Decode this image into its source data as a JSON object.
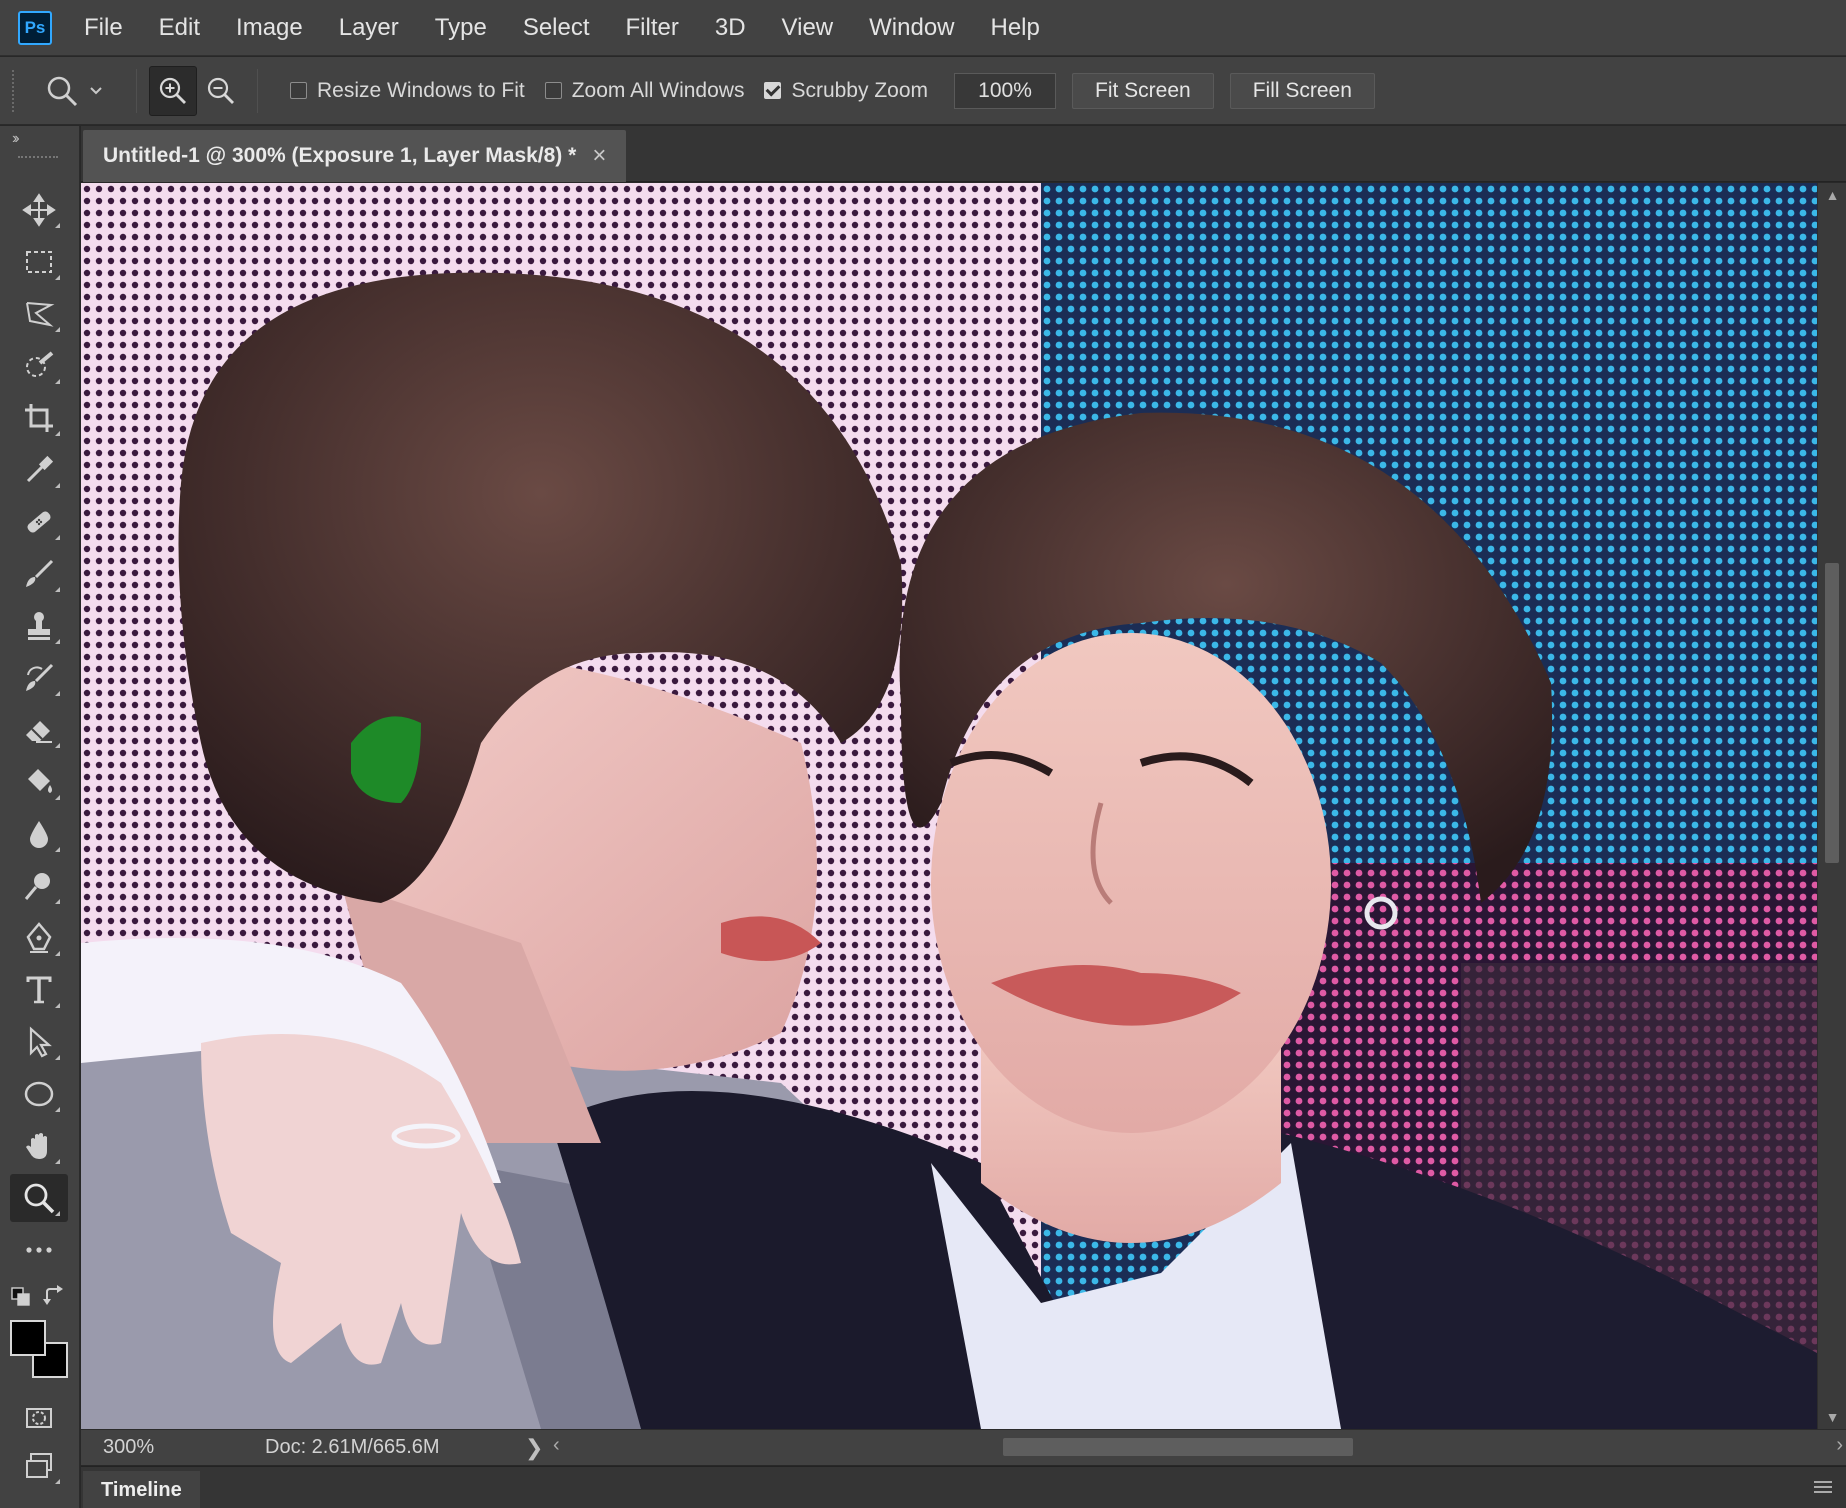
{
  "app": {
    "logo_text": "Ps"
  },
  "menu": [
    "File",
    "Edit",
    "Image",
    "Layer",
    "Type",
    "Select",
    "Filter",
    "3D",
    "View",
    "Window",
    "Help"
  ],
  "options": {
    "resize_windows_to_fit": {
      "label": "Resize Windows to Fit",
      "checked": false
    },
    "zoom_all_windows": {
      "label": "Zoom All Windows",
      "checked": false
    },
    "scrubby_zoom": {
      "label": "Scrubby Zoom",
      "checked": true
    },
    "zoom_value": "100%",
    "fit_screen": "Fit Screen",
    "fill_screen": "Fill Screen"
  },
  "document": {
    "tab_title": "Untitled-1 @ 300% (Exposure 1, Layer Mask/8) *",
    "close_glyph": "×"
  },
  "status": {
    "zoom": "300%",
    "doc": "Doc: 2.61M/665.6M",
    "arrow": "❯"
  },
  "timeline": {
    "label": "Timeline"
  },
  "tools": [
    "move-tool",
    "rectangular-marquee-tool",
    "lasso-tool",
    "quick-selection-tool",
    "crop-tool",
    "eyedropper-tool",
    "healing-brush-tool",
    "brush-tool",
    "clone-stamp-tool",
    "history-brush-tool",
    "eraser-tool",
    "paint-bucket-tool",
    "blur-tool",
    "dodge-tool",
    "pen-tool",
    "type-tool",
    "path-selection-tool",
    "ellipse-tool",
    "hand-tool",
    "zoom-tool",
    "edit-toolbar",
    "quick-mask-mode",
    "screen-mode"
  ],
  "colors": {
    "foreground": "#000000",
    "background": "#000000",
    "accent": "#31a8ff"
  }
}
